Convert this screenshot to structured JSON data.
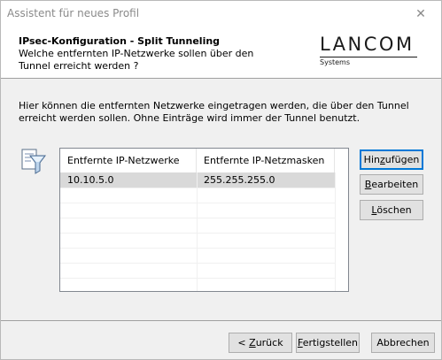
{
  "window": {
    "title": "Assistent für neues Profil",
    "close_glyph": "✕"
  },
  "header": {
    "title": "IPsec-Konfiguration - Split Tunneling",
    "subtitle": "Welche entfernten IP-Netzwerke sollen über den Tunnel erreicht werden ?",
    "logo_brand": "LANCOM",
    "logo_sub": "Systems"
  },
  "intro_text": "Hier können die entfernten Netzwerke eingetragen werden, die über den Tunnel erreicht werden sollen. Ohne Einträge wird immer der Tunnel benutzt.",
  "icons": {
    "filter": "funnel-filter-icon"
  },
  "table": {
    "columns": [
      "Entfernte IP-Netzwerke",
      "Entfernte IP-Netzmasken"
    ],
    "rows": [
      {
        "network": "10.10.5.0",
        "mask": "255.255.255.0",
        "selected": true
      }
    ]
  },
  "side_buttons": {
    "add": {
      "pre": "Hin",
      "ul": "z",
      "post": "ufügen"
    },
    "edit": {
      "pre": "",
      "ul": "B",
      "post": "earbeiten"
    },
    "delete": {
      "pre": "",
      "ul": "L",
      "post": "öschen"
    }
  },
  "footer_buttons": {
    "back": {
      "pre": "< ",
      "ul": "Z",
      "post": "urück"
    },
    "finish": {
      "pre": "",
      "ul": "F",
      "post": "ertigstellen"
    },
    "cancel": {
      "pre": "Abbrechen",
      "ul": "",
      "post": ""
    }
  },
  "colors": {
    "accent": "#0078d7",
    "selection": "#d9d9d9"
  }
}
